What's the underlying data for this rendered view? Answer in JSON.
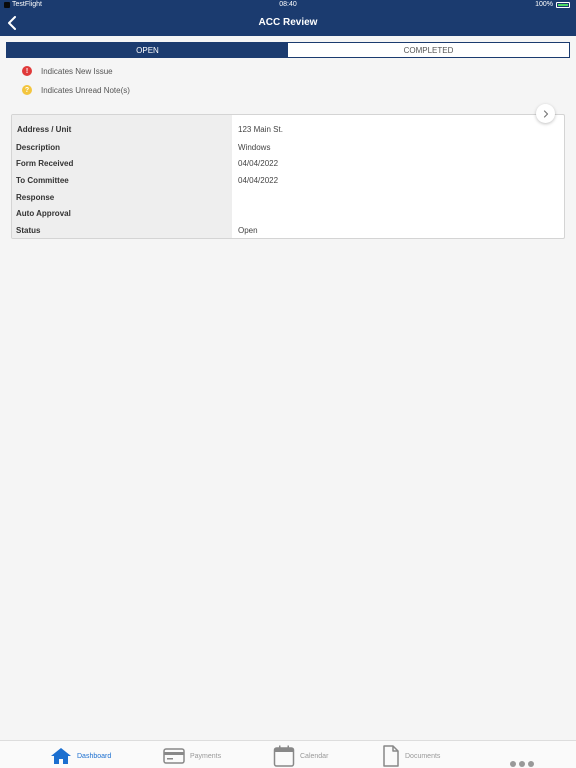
{
  "status_bar": {
    "app": "TestFlight",
    "time": "08:40",
    "battery": "100%"
  },
  "header": {
    "title": "ACC Review"
  },
  "tabs": [
    {
      "label": "OPEN",
      "active": true
    },
    {
      "label": "COMPLETED",
      "active": false
    }
  ],
  "legend": [
    {
      "symbol": "!",
      "text": "Indicates New Issue",
      "color": "#e03a3a"
    },
    {
      "symbol": "?",
      "text": "Indicates Unread Note(s)",
      "color": "#f3c53e"
    }
  ],
  "review": {
    "rows": [
      {
        "label": "Address / Unit",
        "value": "123 Main St."
      },
      {
        "label": "Description",
        "value": "Windows"
      },
      {
        "label": "Form Received",
        "value": "04/04/2022"
      },
      {
        "label": "To Committee",
        "value": "04/04/2022"
      },
      {
        "label": "Response",
        "value": ""
      },
      {
        "label": "Auto Approval",
        "value": ""
      },
      {
        "label": "Status",
        "value": "Open"
      }
    ]
  },
  "tabbar": {
    "items": [
      {
        "label": "Dashboard",
        "icon": "home-icon",
        "active": true
      },
      {
        "label": "Payments",
        "icon": "credit-card-icon",
        "active": false
      },
      {
        "label": "Calendar",
        "icon": "calendar-icon",
        "active": false
      },
      {
        "label": "Documents",
        "icon": "document-icon",
        "active": false
      }
    ]
  },
  "colors": {
    "brand": "#1b3b6f",
    "accent": "#1b6fd0",
    "new_issue": "#e03a3a",
    "unread_note": "#f3c53e"
  }
}
